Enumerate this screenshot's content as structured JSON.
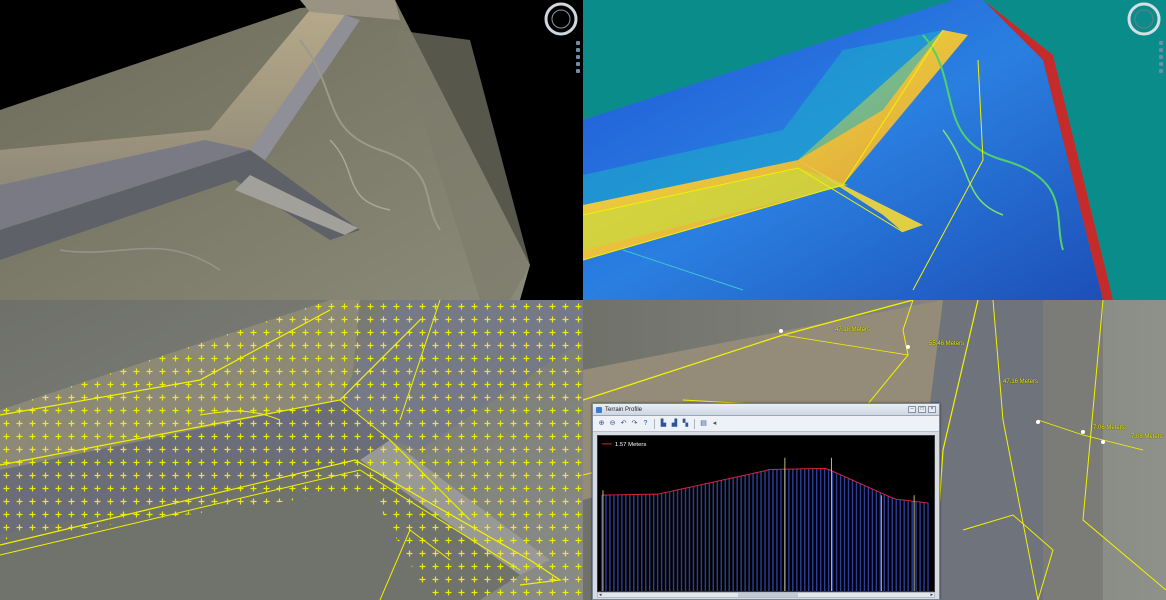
{
  "panels": {
    "top_left": {
      "name": "3D terrain view"
    },
    "top_right": {
      "name": "Elevation color map view"
    },
    "bottom_left": {
      "name": "Grid point overlay view"
    },
    "bottom_right": {
      "name": "Measurement view"
    }
  },
  "measurements": [
    {
      "label": "47.18 Meters"
    },
    {
      "label": "55.46 Meters"
    },
    {
      "label": "47.16 Meters"
    },
    {
      "label": "7.06 Meters"
    },
    {
      "label": "7.08 Meters"
    }
  ],
  "terrain_profile": {
    "title": "Terrain Profile",
    "legend_label": "1.57 Meters",
    "toolbar": [
      "zoom-in",
      "zoom-out",
      "undo",
      "redo",
      "help",
      "chart-bar",
      "chart-area",
      "chart-line",
      "export",
      "settings"
    ],
    "window_buttons": [
      "–",
      "□",
      "×"
    ]
  },
  "colors": {
    "accent_yellow": "#f2f200",
    "teal_background": "#0a8d8a",
    "profile_line": "#d7263d",
    "profile_bars": "#2c3f9e"
  }
}
